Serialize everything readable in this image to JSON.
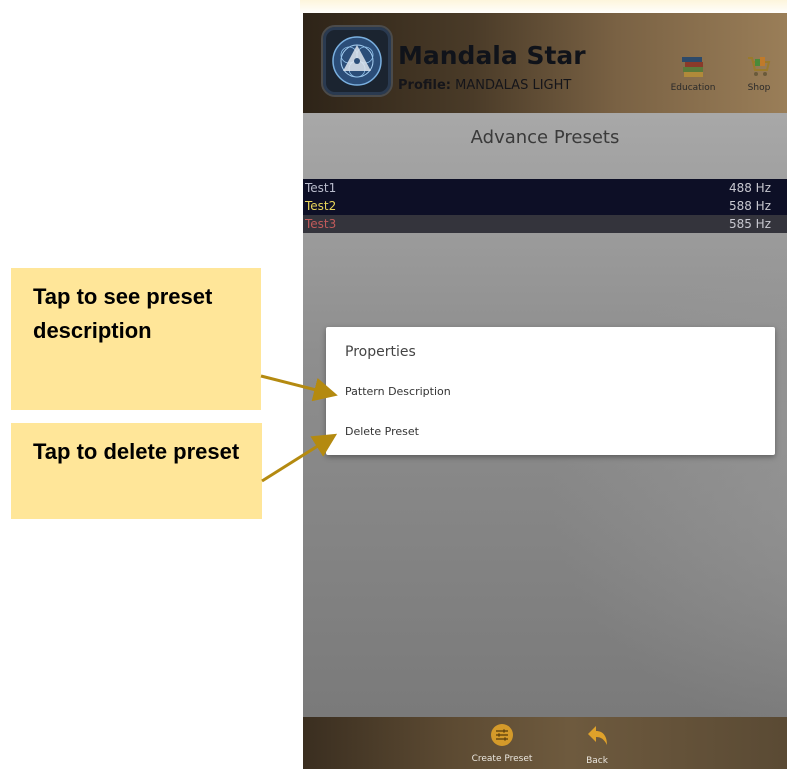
{
  "header": {
    "app_title": "Mandala Star",
    "profile_label": "Profile:",
    "profile_value": "MANDALAS LIGHT",
    "education_label": "Education",
    "shop_label": "Shop"
  },
  "main": {
    "title": "Advance Presets",
    "presets": [
      {
        "name": "Test1",
        "frequency": "488 Hz"
      },
      {
        "name": "Test2",
        "frequency": "588 Hz"
      },
      {
        "name": "Test3",
        "frequency": "585 Hz"
      }
    ]
  },
  "dialog": {
    "title": "Properties",
    "items": [
      "Pattern Description",
      "Delete Preset"
    ]
  },
  "footer": {
    "create_label": "Create Preset",
    "back_label": "Back"
  },
  "callouts": {
    "first": "Tap to see preset description",
    "second": "Tap to delete preset"
  },
  "colors": {
    "callout_bg": "#ffe699",
    "arrow": "#b48a10",
    "list_bg": "#0d0f26",
    "accent_gold": "#d49a2a"
  },
  "icons": {
    "logo": "mandala-logo-icon",
    "education": "books-icon",
    "shop": "shopping-cart-icon",
    "create": "sliders-icon",
    "back": "back-arrow-icon"
  }
}
